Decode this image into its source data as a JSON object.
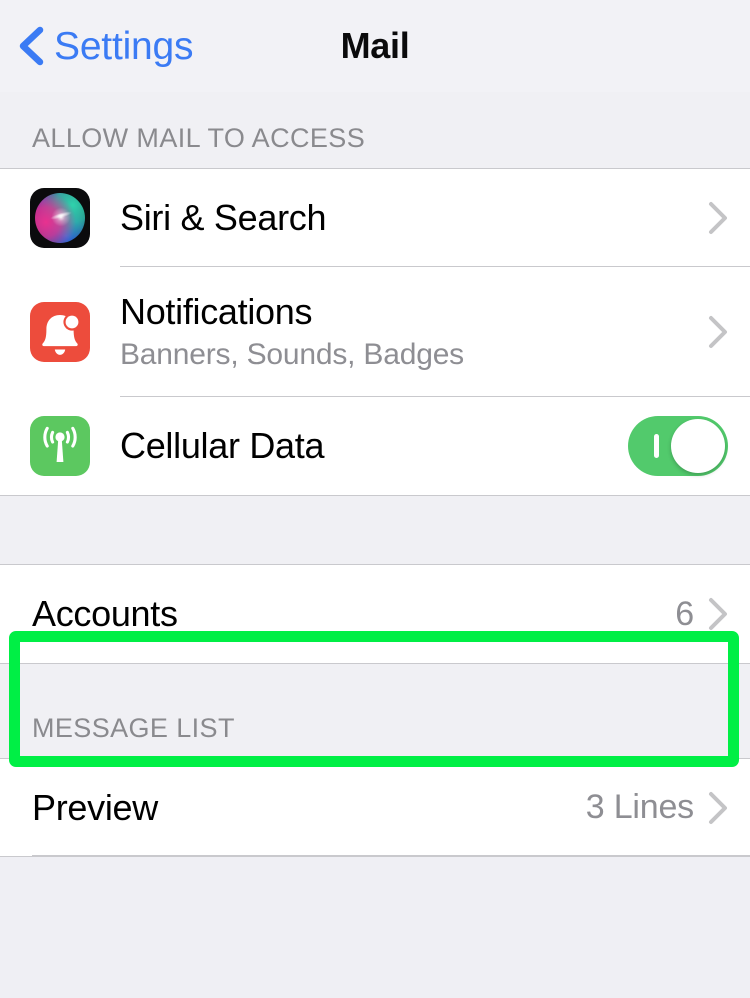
{
  "navbar": {
    "back_label": "Settings",
    "back_icon": "chevron-left-icon",
    "title": "Mail"
  },
  "sections": [
    {
      "header": "ALLOW MAIL TO ACCESS",
      "rows": [
        {
          "title": "Siri & Search",
          "subtitle": "",
          "value": "",
          "icon": "siri-icon",
          "accessory": "chevron-right-icon"
        },
        {
          "title": "Notifications",
          "subtitle": "Banners, Sounds, Badges",
          "value": "",
          "icon": "notifications-bell-icon",
          "accessory": "chevron-right-icon"
        },
        {
          "title": "Cellular Data",
          "subtitle": "",
          "value": "",
          "icon": "cellular-antenna-icon",
          "accessory": "toggle-switch",
          "toggle_state": "on"
        }
      ]
    },
    {
      "header": "",
      "rows": [
        {
          "title": "Accounts",
          "subtitle": "",
          "value": "6",
          "icon": "",
          "accessory": "chevron-right-icon",
          "highlighted": true
        }
      ]
    },
    {
      "header": "MESSAGE LIST",
      "rows": [
        {
          "title": "Preview",
          "subtitle": "",
          "value": "3 Lines",
          "icon": "",
          "accessory": "chevron-right-icon"
        }
      ]
    }
  ],
  "colors": {
    "accent_blue": "#3b7bf4",
    "page_background": "#f0f0f4",
    "row_background": "#ffffff",
    "separator": "#c9c9cd",
    "secondary_text": "#8e8e93",
    "toggle_on": "#52ca6c",
    "highlight_outline": "#00ef45",
    "notifications_icon": "#ed4c3c",
    "cellular_icon": "#5cc860",
    "siri_icon": "#0b0b0d"
  }
}
